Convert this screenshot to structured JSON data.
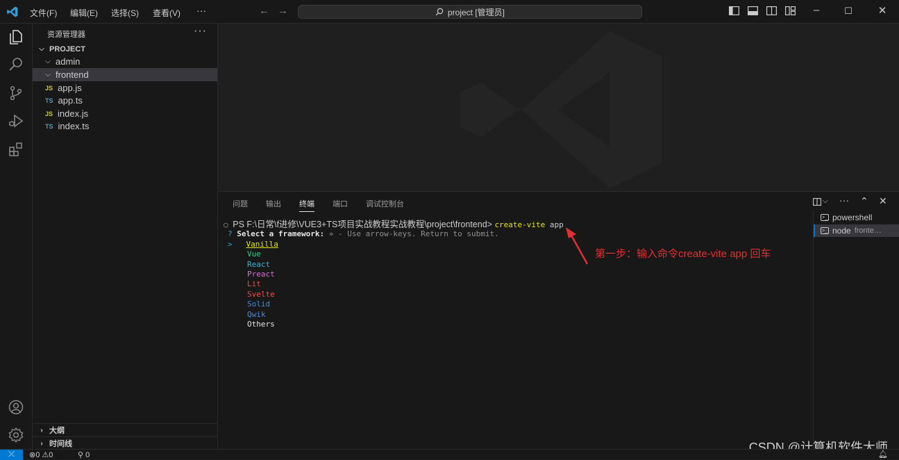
{
  "titlebar": {
    "menus": [
      "文件(F)",
      "编辑(E)",
      "选择(S)",
      "查看(V)",
      "···"
    ],
    "search": "project [管理员]",
    "back_icon": "←",
    "forward_icon": "→"
  },
  "sidebar": {
    "title": "资源管理器",
    "more": "···",
    "tree": [
      {
        "label": "PROJECT",
        "kind": "root"
      },
      {
        "label": "admin",
        "kind": "folder"
      },
      {
        "label": "frontend",
        "kind": "folder",
        "selected": true
      },
      {
        "label": "app.js",
        "kind": "js",
        "badge": "JS"
      },
      {
        "label": "app.ts",
        "kind": "ts",
        "badge": "TS"
      },
      {
        "label": "index.js",
        "kind": "js",
        "badge": "JS"
      },
      {
        "label": "index.ts",
        "kind": "ts",
        "badge": "TS"
      }
    ],
    "sections": [
      "大纲",
      "时间线"
    ]
  },
  "panel": {
    "tabs": [
      "问题",
      "输出",
      "终端",
      "端口",
      "调试控制台"
    ],
    "active_tab": "终端",
    "terminals": [
      {
        "name": "powershell",
        "desc": ""
      },
      {
        "name": "node",
        "desc": "fronte…"
      }
    ]
  },
  "terminal": {
    "prompt": "PS F:\\日常\\f进修\\VUE3+TS项目实战教程实战教程\\project\\frontend> ",
    "command": "create-vite",
    "command_arg": " app",
    "question_mark": "?",
    "question": " Select a framework:",
    "hint": " » - Use arrow-keys. Return to submit.",
    "cursor": ">",
    "options": [
      "Vanilla",
      "Vue",
      "React",
      "Preact",
      "Lit",
      "Svelte",
      "Solid",
      "Qwik",
      "Others"
    ]
  },
  "annotation": "第一步：输入命令create-vite app 回车",
  "watermark": "CSDN @计算机软件大师",
  "statusbar": {
    "errors": "0",
    "warnings": "0",
    "ports": "0"
  },
  "colors": {
    "accent": "#0078d4",
    "annotation": "#e03030"
  }
}
